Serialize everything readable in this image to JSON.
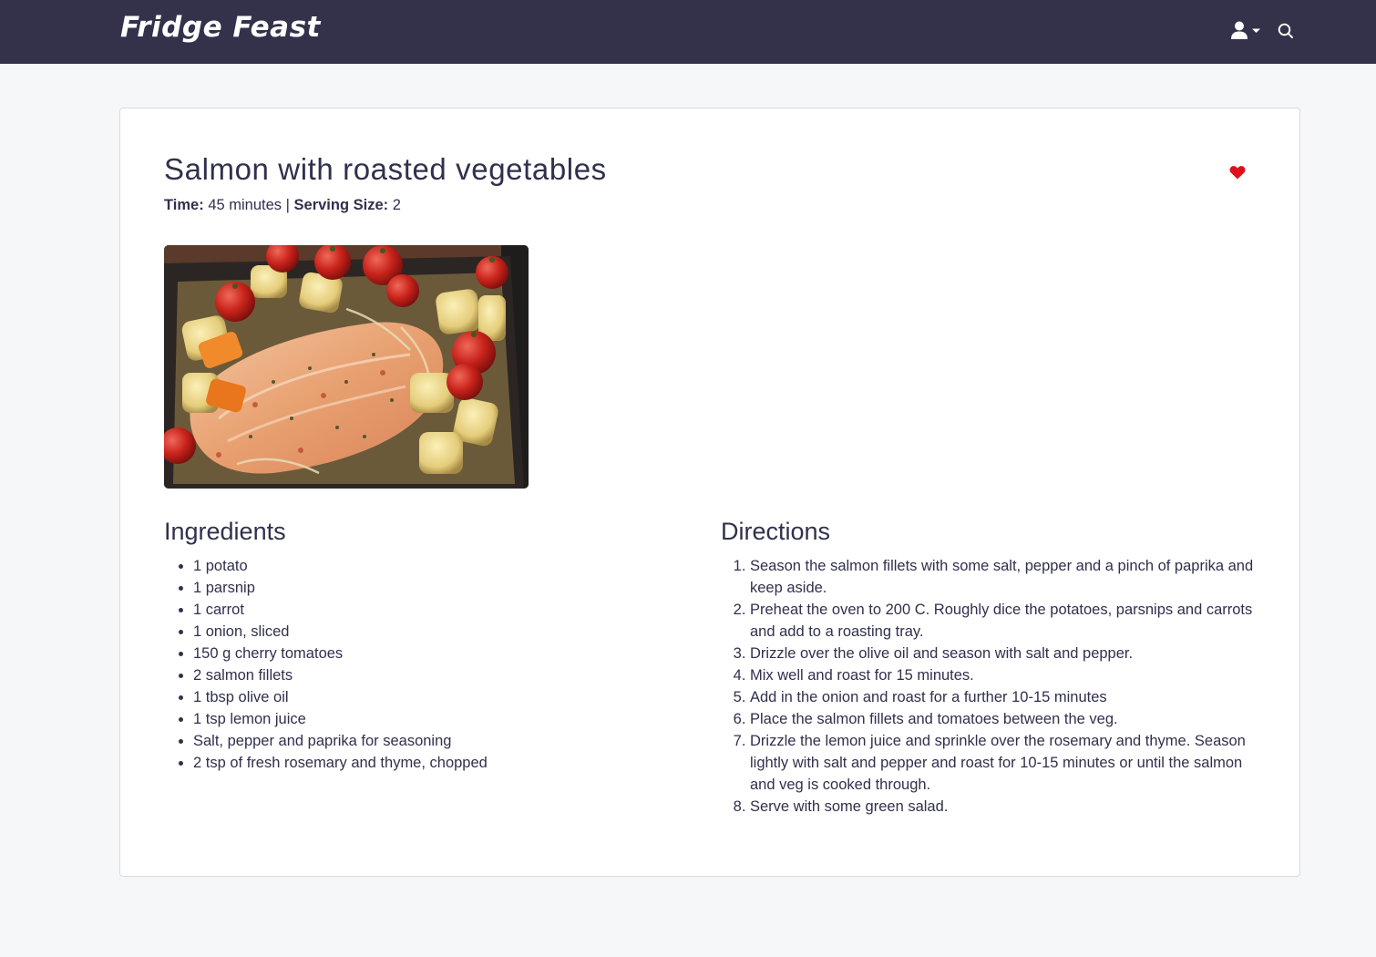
{
  "navbar": {
    "brand": "Fridge Feast",
    "user_icon": "user-icon",
    "dropdown_icon": "caret-down-icon",
    "search_icon": "search-icon",
    "background_color": "#34314b"
  },
  "recipe": {
    "title": "Salmon with roasted vegetables",
    "favorite_icon": "heart-icon",
    "favorite_color": "#e0101a",
    "time_label": "Time:",
    "time_value": "45 minutes",
    "separator": "|",
    "serving_label": "Serving Size:",
    "serving_value": "2",
    "image_subject": "salmon-with-roasted-vegetables-photo"
  },
  "ingredients": {
    "heading": "Ingredients",
    "items": [
      "1 potato",
      "1 parsnip",
      "1 carrot",
      "1 onion, sliced",
      "150 g cherry tomatoes",
      "2 salmon fillets",
      "1 tbsp olive oil",
      "1 tsp lemon juice",
      "Salt, pepper and paprika for seasoning",
      "2 tsp of fresh rosemary and thyme, chopped"
    ]
  },
  "directions": {
    "heading": "Directions",
    "steps": [
      "Season the salmon fillets with some salt, pepper and a pinch of paprika and keep aside.",
      "Preheat the oven to 200 C. Roughly dice the potatoes, parsnips and carrots and add to a roasting tray.",
      "Drizzle over the olive oil and season with salt and pepper.",
      "Mix well and roast for 15 minutes.",
      "Add in the onion and roast for a further 10-15 minutes",
      "Place the salmon fillets and tomatoes between the veg.",
      "Drizzle the lemon juice and sprinkle over the rosemary and thyme. Season lightly with salt and pepper and roast for 10-15 minutes or until the salmon and veg is cooked through.",
      "Serve with some green salad."
    ]
  }
}
